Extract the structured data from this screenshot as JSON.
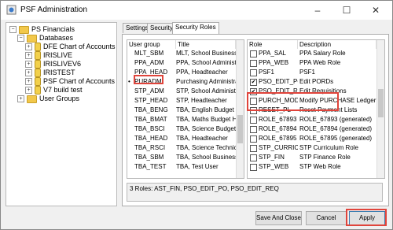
{
  "window": {
    "title": "PSF Administration",
    "minimize": "–",
    "maximize": "☐",
    "close": "✕"
  },
  "tree": {
    "root": "PS Financials",
    "databases": "Databases",
    "items": [
      "DFE Chart of Accounts",
      "IRISLIVE",
      "IRISLIVEV6",
      "IRISTEST",
      "PSF Chart of Accounts",
      "V7 build test"
    ],
    "user_groups": "User Groups"
  },
  "tabs": [
    "Settings",
    "Security",
    "Security Roles"
  ],
  "active_tab": "Security Roles",
  "user_groups_table": {
    "headers": [
      "User group",
      "Title"
    ],
    "rows": [
      {
        "group": "MLT_SBM",
        "title": "MLT, School Business M",
        "marker": ""
      },
      {
        "group": "PPA_ADM",
        "title": "PPA, School Administra",
        "marker": ""
      },
      {
        "group": "PPA_HEAD",
        "title": "PPA, Headteacher",
        "marker": ""
      },
      {
        "group": "PURADM",
        "title": "Purchasing Administrat",
        "marker": "•"
      },
      {
        "group": "STP_ADM",
        "title": "STP, School Administra",
        "marker": ""
      },
      {
        "group": "STP_HEAD",
        "title": "STP, Headteacher",
        "marker": ""
      },
      {
        "group": "TBA_BENG",
        "title": "TBA, English Budget Hol",
        "marker": ""
      },
      {
        "group": "TBA_BMAT",
        "title": "TBA, Maths Budget Hold",
        "marker": ""
      },
      {
        "group": "TBA_BSCI",
        "title": "TBA, Science Budget Hol",
        "marker": ""
      },
      {
        "group": "TBA_HEAD",
        "title": "TBA, Headteacher",
        "marker": ""
      },
      {
        "group": "TBA_RSCI",
        "title": "TBA, Science Technicia",
        "marker": ""
      },
      {
        "group": "TBA_SBM",
        "title": "TBA, School Business M",
        "marker": ""
      },
      {
        "group": "TBA_TEST",
        "title": "TBA, Test User",
        "marker": ""
      }
    ]
  },
  "roles_table": {
    "headers": [
      "Role",
      "Description"
    ],
    "rows": [
      {
        "role": "PPA_SAL",
        "desc": "PPA Salary Role",
        "checked": false
      },
      {
        "role": "PPA_WEB",
        "desc": "PPA Web Role",
        "checked": false
      },
      {
        "role": "PSF1",
        "desc": "PSF1",
        "checked": false
      },
      {
        "role": "PSO_EDIT_PO",
        "desc": "Edit PORDs",
        "checked": true
      },
      {
        "role": "PSO_EDIT_REQ",
        "desc": "Edit Requisitions",
        "checked": true
      },
      {
        "role": "PURCH_MOD",
        "desc": "Modify PURCHASE Ledger Re",
        "checked": false
      },
      {
        "role": "RESET_PL",
        "desc": "Reset Payment Lists",
        "checked": false
      },
      {
        "role": "ROLE_67893",
        "desc": "ROLE_67893 (generated)",
        "checked": false
      },
      {
        "role": "ROLE_67894",
        "desc": "ROLE_67894 (generated)",
        "checked": false
      },
      {
        "role": "ROLE_67895",
        "desc": "ROLE_67895 (generated)",
        "checked": false
      },
      {
        "role": "STP_CURRIC",
        "desc": "STP Curriculum Role",
        "checked": false
      },
      {
        "role": "STP_FIN",
        "desc": "STP Finance Role",
        "checked": false
      },
      {
        "role": "STP_WEB",
        "desc": "STP Web Role",
        "checked": false
      }
    ]
  },
  "summary": "3 Roles: AST_FIN, PSO_EDIT_PO, PSO_EDIT_REQ",
  "buttons": {
    "save_close": "Save And Close",
    "cancel": "Cancel",
    "apply": "Apply"
  },
  "colors": {
    "highlight": "#e0443b",
    "folder": "#f2c84b"
  }
}
